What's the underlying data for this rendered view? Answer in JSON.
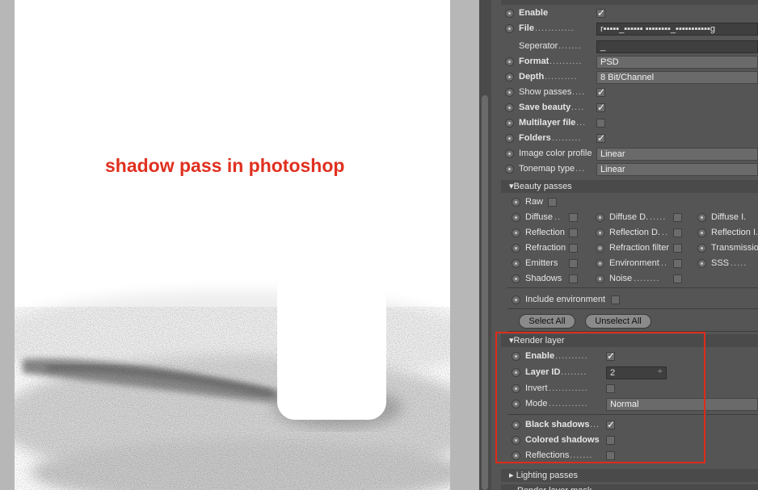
{
  "annotation": {
    "caption": "shadow pass in photoshop"
  },
  "panel": {
    "top_rows": [
      {
        "name": "enable-row",
        "label": "Enable",
        "bold": true,
        "type": "check",
        "checked": true
      },
      {
        "name": "file-row",
        "label": "File",
        "bold": true,
        "dots": "............",
        "type": "field",
        "value": "r▪▪▪▪▪_▪▪▪▪▪▪ ▪▪▪▪▪▪▪▪_▪▪▪▪▪▪▪▪▪▪▪g"
      },
      {
        "name": "separator-row",
        "label": "Seperator",
        "bold": false,
        "dots": ".......",
        "type": "field",
        "value": "_",
        "noradio": true
      },
      {
        "name": "format-row",
        "label": "Format",
        "bold": true,
        "dots": "..........",
        "type": "select",
        "value": "PSD"
      },
      {
        "name": "depth-row",
        "label": "Depth",
        "bold": true,
        "dots": "..........",
        "type": "select",
        "value": "8 Bit/Channel"
      },
      {
        "name": "show-passes-row",
        "label": "Show passes",
        "bold": false,
        "dots": "....",
        "type": "check",
        "checked": true
      },
      {
        "name": "save-beauty-row",
        "label": "Save beauty",
        "bold": true,
        "dots": "....",
        "type": "check",
        "checked": true
      },
      {
        "name": "multilayer-file-row",
        "label": "Multilayer file",
        "bold": true,
        "dots": "...",
        "type": "check",
        "checked": false
      },
      {
        "name": "folders-row",
        "label": "Folders",
        "bold": true,
        "dots": ".........",
        "type": "check",
        "checked": true
      },
      {
        "name": "image-color-profile-row",
        "label": "Image color profile",
        "bold": false,
        "type": "select",
        "value": "Linear"
      },
      {
        "name": "tonemap-type-row",
        "label": "Tonemap type",
        "bold": false,
        "dots": "...",
        "type": "select",
        "value": "Linear"
      }
    ],
    "beauty_section": "Beauty passes",
    "raw_label": "Raw",
    "grid": [
      [
        "Diffuse",
        "Diffuse D.",
        "Diffuse I."
      ],
      [
        "Reflection",
        "Reflection D.",
        "Reflection I."
      ],
      [
        "Refraction",
        "Refraction filter",
        "Transmissio"
      ],
      [
        "Emitters",
        "Environment",
        "SSS"
      ],
      [
        "Shadows",
        "Noise",
        ""
      ]
    ],
    "grid_dots": [
      [
        "..",
        ".....",
        ""
      ],
      [
        "",
        "..",
        ""
      ],
      [
        "",
        "",
        ""
      ],
      [
        "",
        "..",
        "....."
      ],
      [
        "",
        "........",
        ""
      ]
    ],
    "include_environment": "Include environment",
    "select_all": "Select All",
    "unselect_all": "Unselect All",
    "render_layer_section": "Render layer",
    "render_layer_rows": [
      {
        "name": "rl-enable-row",
        "label": "Enable",
        "bold": true,
        "dots": "..........",
        "type": "check",
        "checked": true
      },
      {
        "name": "rl-layer-id-row",
        "label": "Layer ID",
        "bold": true,
        "dots": "........",
        "type": "spin",
        "value": "2"
      },
      {
        "name": "rl-invert-row",
        "label": "Invert",
        "bold": false,
        "dots": "............",
        "type": "check",
        "checked": false
      },
      {
        "name": "rl-mode-row",
        "label": "Mode",
        "bold": false,
        "dots": "............",
        "type": "select",
        "value": "Normal"
      },
      {
        "name": "rl-black-shadows-row",
        "label": "Black shadows",
        "bold": true,
        "dots": "...",
        "type": "check",
        "checked": true
      },
      {
        "name": "rl-colored-shadows-row",
        "label": "Colored shadows",
        "bold": true,
        "dots": "",
        "type": "check",
        "checked": false
      },
      {
        "name": "rl-reflections-row",
        "label": "Reflections",
        "bold": false,
        "dots": ".......",
        "type": "check",
        "checked": false
      }
    ],
    "lighting_section": "Lighting passes",
    "render_layer_mask_section": "Render layer mask"
  }
}
